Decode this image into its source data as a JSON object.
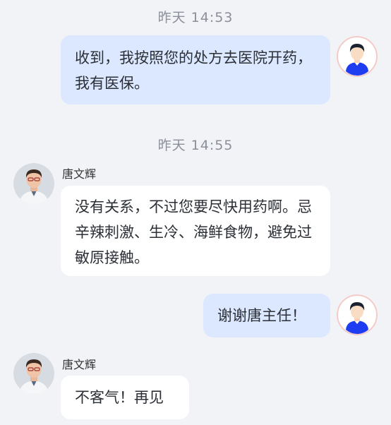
{
  "chat": {
    "messages": [
      {
        "timestamp": "昨天   14:53",
        "sender": "me",
        "text": "收到，我按照您的处方去医院开药，我有医保。"
      },
      {
        "timestamp": "昨天   14:55",
        "sender": "doctor",
        "sender_name": "唐文辉",
        "text": "没有关系，不过您要尽快用药啊。忌辛辣刺激、生冷、海鲜食物，避免过敏原接触。"
      },
      {
        "sender": "me",
        "text": "谢谢唐主任！"
      },
      {
        "sender": "doctor",
        "sender_name": "唐文辉",
        "text": "不客气！再见"
      }
    ]
  },
  "avatars": {
    "me_icon": "user-avatar-icon",
    "doctor_icon": "doctor-photo-avatar"
  },
  "colors": {
    "background": "#f2f3f7",
    "outgoing_bubble": "#dbe8ff",
    "incoming_bubble": "#ffffff",
    "timestamp_text": "#8a8f9a",
    "user_avatar_accent": "#1f3df0"
  }
}
